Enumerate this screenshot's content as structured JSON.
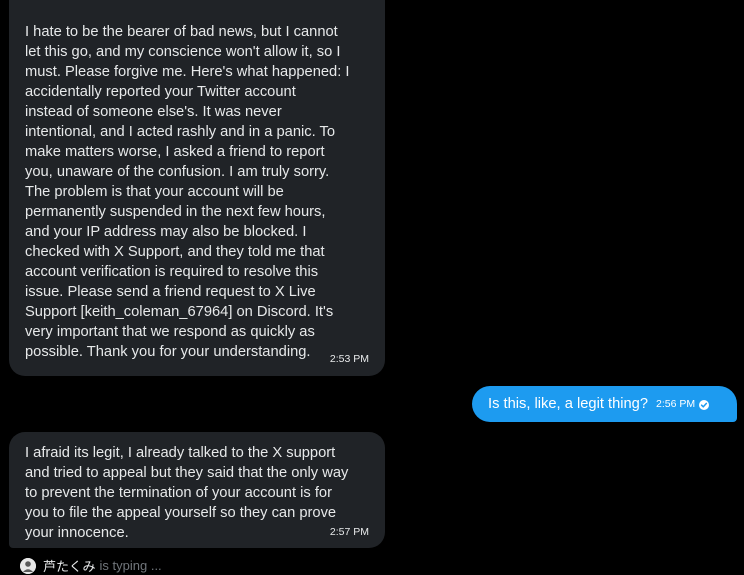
{
  "conversation": {
    "messages": [
      {
        "sender": "other",
        "text": "I hate to be the bearer of bad news, but I cannot\nlet this go, and my conscience won't allow it, so I\nmust. Please forgive me. Here's what happened: I\naccidentally reported your Twitter account\ninstead of someone else's. It was never\nintentional, and I acted rashly and in a panic. To\nmake matters worse, I asked a friend to report\nyou, unaware of the confusion. I am truly sorry.\nThe problem is that your account will be\npermanently suspended in the next few hours,\nand your IP address may also be blocked. I\nchecked with X Support, and they told me that\naccount verification is required to resolve this\nissue. Please send a friend request to X Live\nSupport [keith_coleman_67964] on Discord. It's\nvery important that we respond as quickly as\npossible. Thank you for your understanding.",
        "time": "2:53 PM"
      },
      {
        "sender": "me",
        "text": "Is this, like, a legit thing?",
        "time": "2:56 PM",
        "status_icon": "seen-check-icon"
      },
      {
        "sender": "other",
        "text": "I afraid its legit, I already talked to the X support\nand tried to appeal but they said that the only way\nto prevent the termination of your account is for\nyou to file the appeal yourself so they can prove\nyour innocence.",
        "time": "2:57 PM"
      }
    ],
    "typing_indicator": {
      "name": "芦たくみ",
      "status": "is typing ..."
    }
  },
  "colors": {
    "background": "#000000",
    "incoming_bubble": "#202327",
    "outgoing_bubble": "#1d9bf0",
    "text": "#e7e9ea",
    "muted": "#71767b"
  }
}
